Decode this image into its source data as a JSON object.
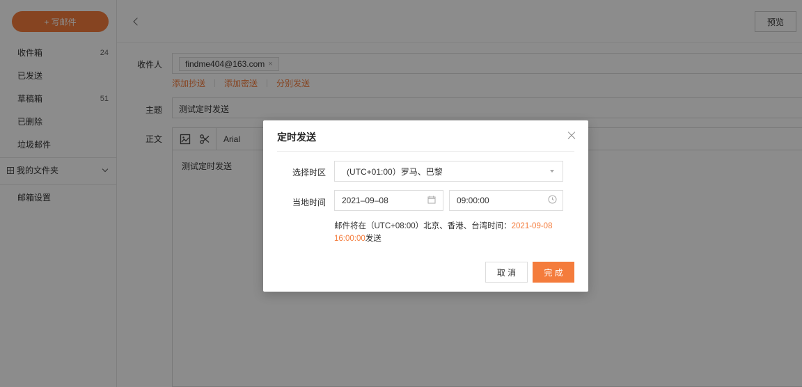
{
  "sidebar": {
    "compose_label": "+ 写邮件",
    "items": [
      {
        "label": "收件箱",
        "count": "24"
      },
      {
        "label": "已发送",
        "count": ""
      },
      {
        "label": "草稿箱",
        "count": "51"
      },
      {
        "label": "已删除",
        "count": ""
      },
      {
        "label": "垃圾邮件",
        "count": ""
      }
    ],
    "folders_label": "我的文件夹",
    "settings_label": "邮箱设置"
  },
  "header": {
    "preview_label": "预览"
  },
  "compose": {
    "recipient_label": "收件人",
    "recipient_chip": "findme404@163.com",
    "chip_remove": "×",
    "add_cc": "添加抄送",
    "add_bcc": "添加密送",
    "separate_send": "分别发送",
    "subject_label": "主题",
    "subject_value": "测试定时发送",
    "body_label": "正文",
    "font_name": "Arial",
    "body_text": "测试定时发送"
  },
  "modal": {
    "title": "定时发送",
    "timezone_label": "选择时区",
    "timezone_value": "(UTC+01:00）罗马、巴黎",
    "local_time_label": "当地时间",
    "date_value": "2021–09–08",
    "time_value": "09:00:00",
    "info_prefix": "邮件将在（UTC+08:00）北京、香港、台湾时间：",
    "info_time": "2021-09-08 16:00:00",
    "info_suffix": "发送",
    "cancel_label": "取 消",
    "ok_label": "完 成"
  },
  "colors": {
    "accent": "#f47c3c",
    "overlay": "rgba(0,0,0,0.45)"
  }
}
